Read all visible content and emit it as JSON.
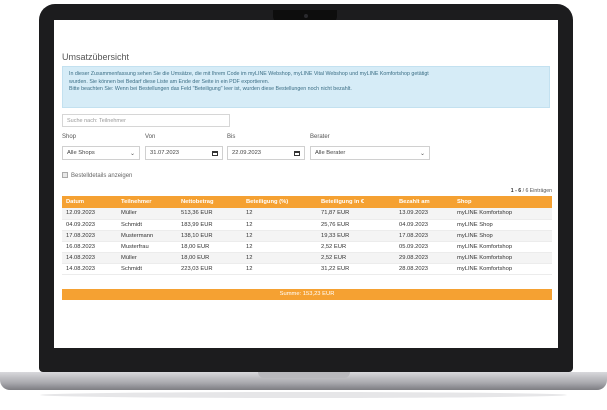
{
  "page": {
    "title": "Umsatzübersicht",
    "info_lines": [
      "In dieser Zusammenfassung sehen Sie die Umsätze, die mit Ihrem Code im myLINE Webshop, myLINE Vital Webshop und myLINE Komfortshop getätigt",
      "wurden. Sie können bei Bedarf diese Liste am Ende der Seite in ein PDF exportieren.",
      "Bitte beachten Sie: Wenn bei Bestellungen das Feld \"Beteiligung\" leer ist, wurden diese Bestellungen noch nicht bezahlt."
    ],
    "search_placeholder": "Suche nach: Teilnehmer"
  },
  "filters": {
    "shop_label": "Shop",
    "shop_value": "Alle Shops",
    "from_label": "Von",
    "from_value": "31.07.2023",
    "to_label": "Bis",
    "to_value": "22.09.2023",
    "advisor_label": "Berater",
    "advisor_value": "Alle Berater",
    "details_label": "Bestelldetails anzeigen"
  },
  "table": {
    "count_prefix": "1 - 6",
    "count_suffix": " / 6 Einträgen",
    "columns": [
      "Datum",
      "Teilnehmer",
      "Nettobetrag",
      "Beteiligung (%)",
      "Beteiligung in €",
      "Bezahlt am",
      "Shop"
    ],
    "rows": [
      [
        "12.09.2023",
        "Müller",
        "513,36 EUR",
        "12",
        "71,87 EUR",
        "13.09.2023",
        "myLINE Komfortshop"
      ],
      [
        "04.09.2023",
        "Schmidt",
        "183,99 EUR",
        "12",
        "25,76 EUR",
        "04.09.2023",
        "myLINE Shop"
      ],
      [
        "17.08.2023",
        "Mustermann",
        "138,10 EUR",
        "12",
        "19,33 EUR",
        "17.08.2023",
        "myLINE Shop"
      ],
      [
        "16.08.2023",
        "Musterfrau",
        "18,00 EUR",
        "12",
        "2,52 EUR",
        "05.09.2023",
        "myLINE Komfortshop"
      ],
      [
        "14.08.2023",
        "Müller",
        "18,00 EUR",
        "12",
        "2,52 EUR",
        "29.08.2023",
        "myLINE Komfortshop"
      ],
      [
        "14.08.2023",
        "Schmidt",
        "223,03 EUR",
        "12",
        "31,22 EUR",
        "28.08.2023",
        "myLINE Komfortshop"
      ]
    ],
    "sum_label": "Summe: 153,23 EUR"
  },
  "colors": {
    "accent": "#f5a132",
    "info_bg": "#d6ecf7",
    "info_text": "#3b6e85",
    "bezel": "#1c1c1e"
  },
  "icons": [
    "chevron-down-icon",
    "calendar-icon",
    "checkbox-icon",
    "camera-icon"
  ]
}
